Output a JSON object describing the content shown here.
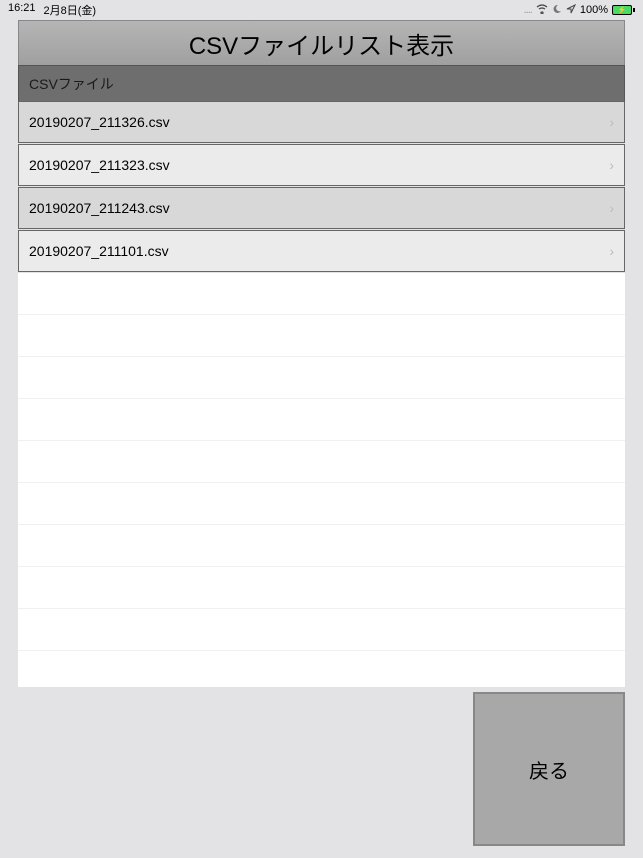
{
  "status": {
    "time": "16:21",
    "date": "2月8日(金)",
    "dots": "....",
    "battery_pct": "100%"
  },
  "header": {
    "title": "CSVファイルリスト表示"
  },
  "section": {
    "label": "CSVファイル"
  },
  "files": [
    {
      "name": "20190207_211326.csv"
    },
    {
      "name": "20190207_211323.csv"
    },
    {
      "name": "20190207_211243.csv"
    },
    {
      "name": "20190207_211101.csv"
    }
  ],
  "buttons": {
    "back": "戻る"
  }
}
